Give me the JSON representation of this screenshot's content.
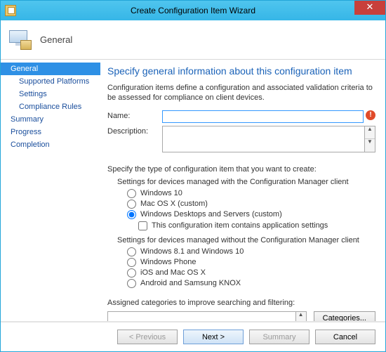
{
  "window": {
    "title": "Create Configuration Item Wizard",
    "close": "✕"
  },
  "banner": {
    "title": "General"
  },
  "nav": {
    "general": "General",
    "supported": "Supported Platforms",
    "settings": "Settings",
    "compliance": "Compliance Rules",
    "summary": "Summary",
    "progress": "Progress",
    "completion": "Completion"
  },
  "main": {
    "heading": "Specify general information about this configuration item",
    "intro": "Configuration items define a configuration and associated validation criteria to be assessed for compliance on client devices.",
    "name_label": "Name:",
    "name_value": "",
    "desc_label": "Description:",
    "desc_value": "",
    "error_glyph": "!",
    "type_intro": "Specify the type of configuration item that you want to create:",
    "group_with": "Settings for devices managed with the Configuration Manager client",
    "opt_win10": "Windows 10",
    "opt_macosx": "Mac OS X (custom)",
    "opt_windesk": "Windows Desktops and Servers (custom)",
    "chk_appsettings": "This configuration item contains application settings",
    "group_without": "Settings for devices managed without the Configuration Manager client",
    "opt_win81": "Windows 8.1 and Windows 10",
    "opt_wp": "Windows Phone",
    "opt_ios": "iOS and Mac OS X",
    "opt_android": "Android and Samsung KNOX",
    "cat_label": "Assigned categories to improve searching and filtering:",
    "cat_value": "",
    "cat_button": "Categories..."
  },
  "footer": {
    "prev": "< Previous",
    "next": "Next >",
    "summary": "Summary",
    "cancel": "Cancel"
  }
}
